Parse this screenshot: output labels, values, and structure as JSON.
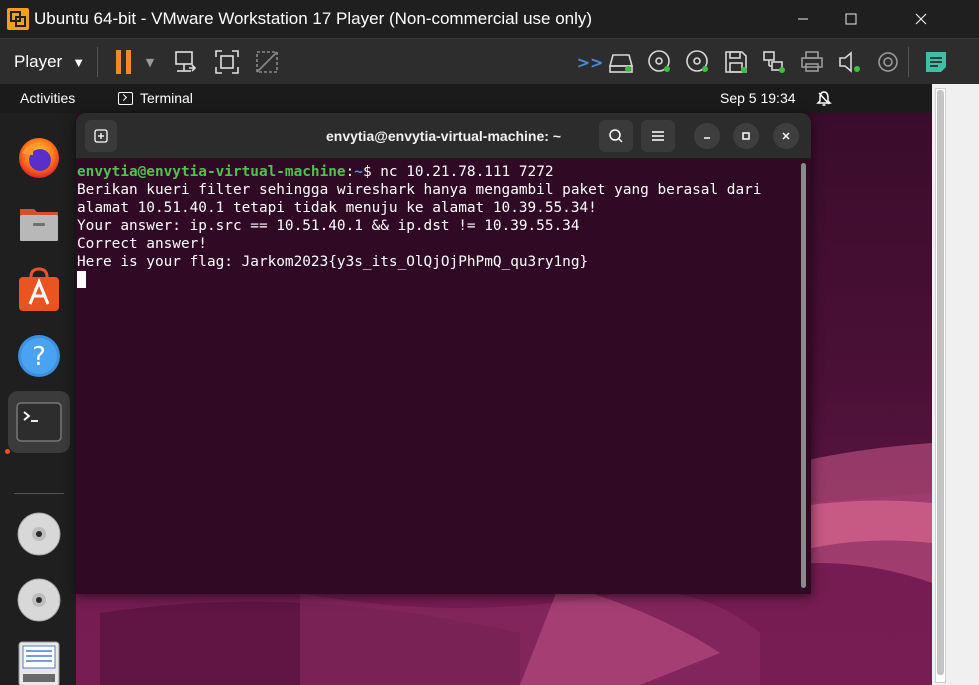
{
  "vm_window": {
    "title": "Ubuntu 64-bit - VMware Workstation 17 Player (Non-commercial use only)",
    "minimize_icon": "minimize-icon",
    "maximize_icon": "maximize-icon",
    "close_icon": "close-icon"
  },
  "toolbar": {
    "player_label": "Player",
    "icons": [
      "pause-icon",
      "send-ctrl-alt-del-icon",
      "fit-guest-icon",
      "unity-icon",
      "more-arrows-icon",
      "hard-disk-icon",
      "cd-icon",
      "cd-icon",
      "floppy-icon",
      "network-icon",
      "printer-icon",
      "sound-icon",
      "usb-icon",
      "message-log-icon"
    ]
  },
  "gnome_top_bar": {
    "activities": "Activities",
    "app_name": "Terminal",
    "clock": "Sep 5  19:34"
  },
  "dock": {
    "items": [
      "firefox",
      "files",
      "app-center",
      "help",
      "terminal",
      "dvd-drive",
      "dvd-drive",
      "text-editor"
    ]
  },
  "terminal": {
    "title": "envytia@envytia-virtual-machine: ~",
    "prompt_user": "envytia@envytia-virtual-machine",
    "prompt_sep": ":",
    "prompt_path": "~",
    "prompt_end": "$ ",
    "command": "nc 10.21.78.111 7272",
    "output": [
      "Berikan kueri filter sehingga wireshark hanya mengambil paket yang berasal dari",
      "alamat 10.51.40.1 tetapi tidak menuju ke alamat 10.39.55.34!",
      "Your answer: ip.src == 10.51.40.1 && ip.dst != 10.39.55.34",
      "Correct answer!",
      "Here is your flag: Jarkom2023{y3s_its_OlQjOjPhPmQ_qu3ry1ng}"
    ]
  },
  "colors": {
    "terminal_bg": "#300a24",
    "prompt_user": "#4fc34f",
    "prompt_path": "#5c8edc",
    "accent_orange": "#f08b24",
    "active_dot": "#e95420"
  }
}
